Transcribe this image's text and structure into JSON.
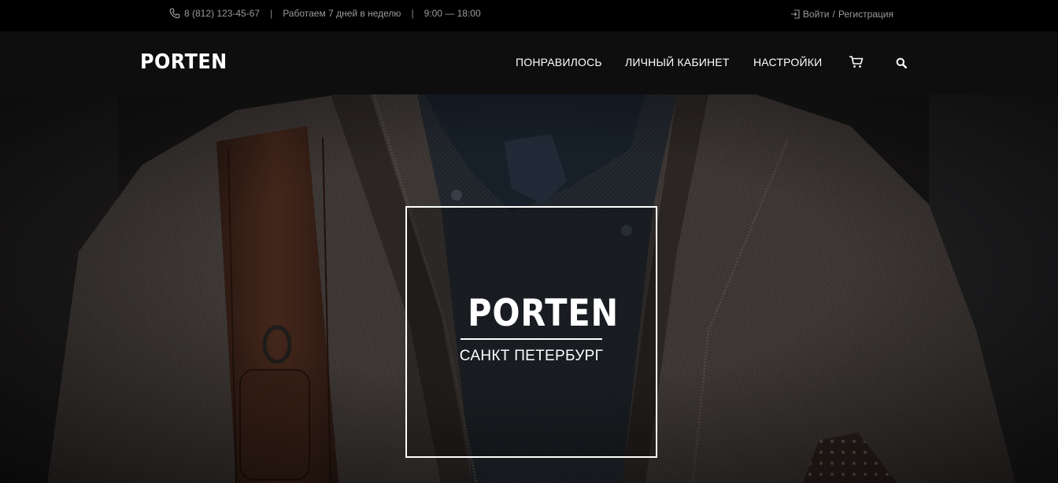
{
  "topbar": {
    "phone": "8 (812) 123-45-67",
    "separator": "|",
    "hours_label": "Работаем 7 дней в неделю",
    "hours_time": "9:00 — 18:00",
    "login_label": "Войти",
    "auth_separator": "/",
    "register_label": "Регистрация"
  },
  "header": {
    "logo_text": "PORTEN",
    "nav": [
      {
        "label": "ПОНРАВИЛОСЬ"
      },
      {
        "label": "ЛИЧНЫЙ КАБИНЕТ"
      },
      {
        "label": "НАСТРОЙКИ"
      }
    ],
    "icons": {
      "cart": "cart-icon",
      "search": "search-icon",
      "phone": "phone-icon",
      "login": "login-icon"
    }
  },
  "hero": {
    "logo_text": "PORTEN",
    "city": "САНКТ ПЕТЕРБУРГ"
  },
  "colors": {
    "topbar_bg": "#000000",
    "navbar_bg": "#0e0e0e",
    "muted_text": "#9a9a9a",
    "text": "#ffffff"
  }
}
